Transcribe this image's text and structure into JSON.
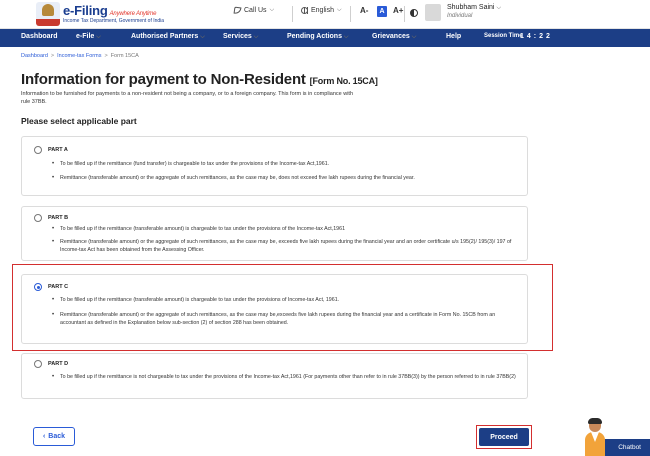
{
  "header": {
    "logo_title": "e-Filing",
    "logo_tagline": "Anywhere Anytime",
    "logo_subtitle": "Income Tax Department, Government of India",
    "call_us": "Call Us",
    "language": "English",
    "font_small": "A-",
    "font_default": "A",
    "font_large": "A+",
    "user_name": "Shubham Saini",
    "user_role": "Individual"
  },
  "nav": {
    "items": [
      "Dashboard",
      "e-File",
      "Authorised Partners",
      "Services",
      "Pending Actions",
      "Grievances",
      "Help"
    ],
    "session_label": "Session Time",
    "session_time": "14:22"
  },
  "breadcrumb": {
    "items": [
      "Dashboard",
      "Income-tax Forms",
      "Form 15CA"
    ]
  },
  "page": {
    "title": "Information for payment to Non-Resident",
    "form_no": "[Form No. 15CA]",
    "description": "Information to be furnished for payments to a non-resident not being a company, or to a foreign company. This form is in compliance with rule 37BB.",
    "section_title": "Please select applicable part"
  },
  "parts": [
    {
      "label": "PART A",
      "selected": false,
      "bullets": [
        "To be filled up if the remittance (fund transfer) is chargeable to tax under the provisions of the Income-tax Act,1961.",
        "Remittance (transferable amount) or the aggregate of such remittances, as the case may be, does not exceed five lakh rupees during the financial year."
      ]
    },
    {
      "label": "PART B",
      "selected": false,
      "bullets": [
        "To be filled up if the remittance (transferable amount) is chargeable to tax under the provisions of the Income-tax Act,1961",
        "Remittance (transferable amount) or the aggregate of such remittances, as the case may be, exceeds five lakh rupees during the financial year and an order certificate u/s 195(2)/ 195(3)/ 197 of Income-tax Act has been obtained from the Assessing Officer."
      ]
    },
    {
      "label": "PART C",
      "selected": true,
      "bullets": [
        "To be filled up if the remittance (transferable amount) is chargeable to tax under the provisions of Income-tax Act, 1961.",
        "Remittance (transferable amount) or the aggregate of such remittances, as the case may be,exceeds five lakh rupees during the financial year and a certificate in Form No. 15CB from an accountant as defined in the Explanation below sub-section (2) of section 288 has been obtained."
      ]
    },
    {
      "label": "PART D",
      "selected": false,
      "bullets": [
        "To be filled up if the remittance is not chargeable to tax under the provisions of the Income-tax Act,1961 (For payments other than refer to in rule 37BB(3)) by the person referred to in rule 37BB(2)"
      ]
    }
  ],
  "actions": {
    "back_label": "Back",
    "proceed_label": "Proceed"
  },
  "chatbot": {
    "label": "Chatbot"
  },
  "colors": {
    "brand_navy": "#1c3e86",
    "link_blue": "#2a5bd7",
    "highlight_red": "#d32f2f"
  }
}
